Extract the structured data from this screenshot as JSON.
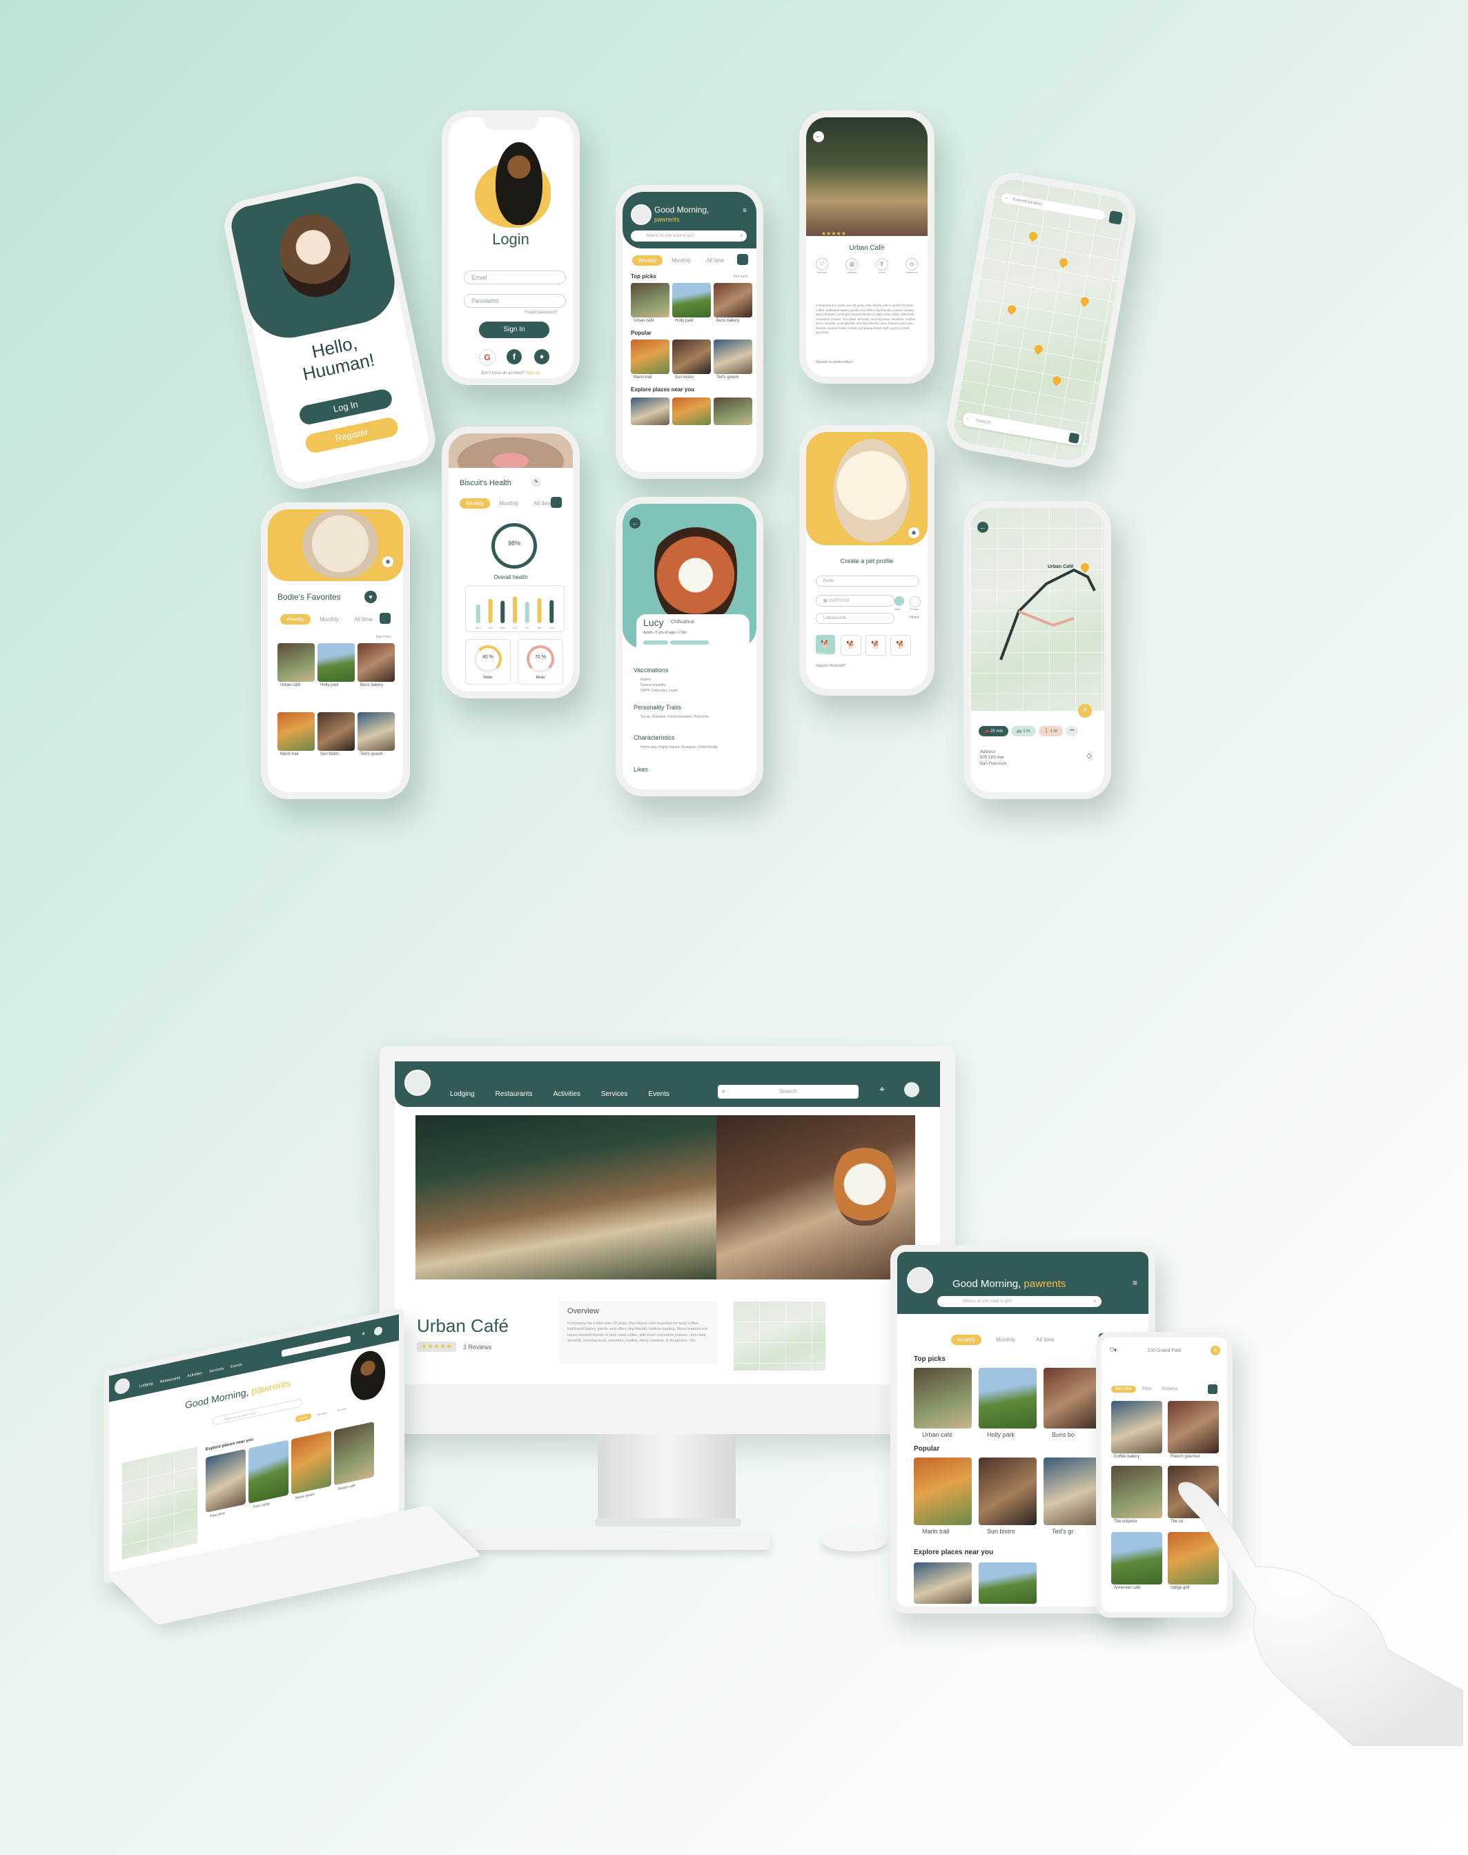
{
  "brand": {
    "teal": "#325a56",
    "yellow": "#f2c455",
    "bg": "#d9eee3"
  },
  "welcome": {
    "greeting": "Hello, Huuman!",
    "login": "Log In",
    "register": "Register"
  },
  "login": {
    "title": "Login",
    "email": "Email",
    "password": "Password",
    "forgot": "Forgot password?",
    "sign_in": "Sign In",
    "signup_prompt": "Don't have an account?",
    "signup": "Sign up"
  },
  "home": {
    "greeting": "Good Morning,",
    "user": "pawrents",
    "search": "Where do you want to go?",
    "tabs": [
      "Weekly",
      "Monthly",
      "All time"
    ],
    "top_picks": "Top picks",
    "popular": "Popular",
    "explore": "Explore places near you",
    "see_more": "See more",
    "top_items": [
      "Urban café",
      "Holly park",
      "Buns bakery"
    ],
    "popular_items": [
      "Marin trail",
      "Sun bistro",
      "Ted's groom"
    ]
  },
  "detail": {
    "title": "Urban Café",
    "actions": [
      "Favorite",
      "Website",
      "Share",
      "Directions"
    ],
    "body": "In business for a little over 10 years, this cheery cafe is perfect for tasty coffee, traditional bakery goods, and offers dog-friendly outdoor seating. Menu features our house-brewed blonde to dark roast coffee, with fresh croissants (classic, chocolate, almond), morning buns, danishes, muffins, berry custards, & doughnuts. Our dog-friendly menu features pup cups, biscuits, peanut butter cookies, & banana bread. WiFi open to small purchase.",
    "special": "Special on wednesdays!"
  },
  "map": {
    "current": "Current location",
    "search": "Search"
  },
  "favorites": {
    "title": "Bodie's Favorites",
    "tabs": [
      "Weekly",
      "Monthly",
      "All time"
    ],
    "see_more": "See more",
    "row1": [
      "Urban café",
      "Holly park",
      "Buns bakery"
    ],
    "row2": [
      "Marin trail",
      "Sun bistro",
      "Ted's groom"
    ]
  },
  "health": {
    "title": "Biscuit's Health",
    "tabs": [
      "Weekly",
      "Monthly",
      "All time"
    ],
    "score": "98%",
    "overall": "Overall health",
    "bars": [
      62,
      80,
      74,
      88,
      70,
      82,
      76
    ],
    "days": [
      "Mon",
      "Tue",
      "Wed",
      "Thu",
      "Fri",
      "Sat",
      "Sun"
    ],
    "ring1": "40 %",
    "ring1_label": "Walks",
    "ring2": "70 %",
    "ring2_label": "Meals"
  },
  "profile": {
    "name": "Lucy",
    "breed": "Chihuahua",
    "meta": [
      "Adult",
      "5 yrs of age",
      "7 lbs"
    ],
    "vaccinations": "Vaccinations",
    "vacc_list": [
      "Rabies",
      "Canine hepatitis",
      "DHPP, Distemper, Lepto"
    ],
    "traits": "Personality Traits",
    "traits_text": "Social, Obedient, Food motivated, Protective",
    "characteristics": "Characteristics",
    "char_text": "Home dog, Highly trained, Energetic, Child friendly",
    "likes": "Likes"
  },
  "create": {
    "title": "Create a pet profile",
    "name": "Bodie",
    "date": "10/07/2018",
    "breed": "Labradoodle",
    "sex": [
      "Male",
      "Female",
      "Mixed"
    ],
    "sizes": [
      "0-25 lbs"
    ],
    "spayed": "Spayed/ Neutered?"
  },
  "route": {
    "place": "Urban Café",
    "chips": [
      "25 min",
      "1 hr",
      "1 hr"
    ],
    "address_label": "Address",
    "address_line1": "505 11th Ave",
    "address_line2": "San Francisco"
  },
  "desktop": {
    "nav": [
      "Lodging",
      "Restaurants",
      "Activities",
      "Services",
      "Events"
    ],
    "search": "Search",
    "title": "Urban Café",
    "reviews": "3 Reviews",
    "overview": "Overview",
    "overview_text": "In business for a little over 10 years, this cheery cafe is perfect for tasty coffee, traditional bakery goods, and offers dog-friendly outdoor seating. Menu features our house-brewed blonde to dark roast coffee, with fresh croissants (classic, chocolate, almond), morning buns, danishes, muffins, berry custards, & doughnuts. Our"
  },
  "laptop": {
    "nav": [
      "Lodging",
      "Restaurants",
      "Activities",
      "Services",
      "Events"
    ],
    "greeting": "Good Morning,",
    "user": "pawrents",
    "search": "Where do you want to go?",
    "tabs": [
      "Weekly",
      "Monthly",
      "All time"
    ],
    "explore": "Explore places near you",
    "items": [
      "Paw clinic",
      "Train camp",
      "Baker beach",
      "Beach café"
    ]
  },
  "tablet": {
    "greeting": "Good Morning,",
    "user": "pawrents",
    "search": "Where do you want to go?",
    "tabs": [
      "Weekly",
      "Monthly",
      "All time"
    ],
    "top_picks": "Top picks",
    "popular": "Popular",
    "explore": "Explore places near you",
    "top_items": [
      "Urban café",
      "Holly park",
      "Buns bo"
    ],
    "popular_items": [
      "Marin trail",
      "Sun bistro",
      "Ted's gr"
    ]
  },
  "mobile_small": {
    "location": "100 Grand Park",
    "tabs": [
      "Best Mat",
      "Price",
      "Distance"
    ],
    "items": [
      "Coffee bakery",
      "French gourmet",
      "The crêperie",
      "The co",
      "Armenian café",
      "Indigo grill"
    ]
  }
}
